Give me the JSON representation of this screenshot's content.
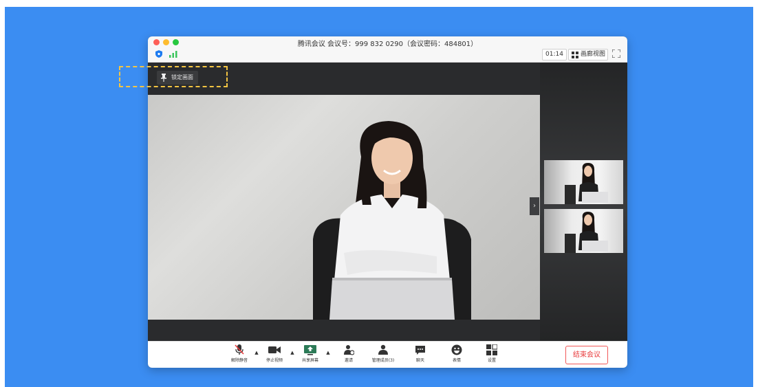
{
  "window": {
    "title": "腾讯会议 会议号：999 832 0290（会议密码：484801）"
  },
  "status": {
    "timer": "01:14",
    "view_label": "画廊视图"
  },
  "overlay": {
    "pin_label": "锁定画面"
  },
  "toolbar": {
    "items": [
      {
        "label": "解除静音",
        "icon": "muted-mic-icon"
      },
      {
        "label": "停止视频",
        "icon": "video-camera-icon"
      },
      {
        "label": "共享屏幕",
        "icon": "share-screen-icon"
      },
      {
        "label": "邀请",
        "icon": "invite-user-icon"
      },
      {
        "label": "管理成员(3)",
        "icon": "members-icon"
      },
      {
        "label": "聊天",
        "icon": "chat-icon"
      },
      {
        "label": "表情",
        "icon": "emoji-icon"
      },
      {
        "label": "设置",
        "icon": "settings-grid-icon"
      }
    ],
    "end_label": "结束会议"
  },
  "colors": {
    "background": "#3b8df2",
    "end_button": "#e8393a",
    "highlight_dash": "#f5c542"
  }
}
